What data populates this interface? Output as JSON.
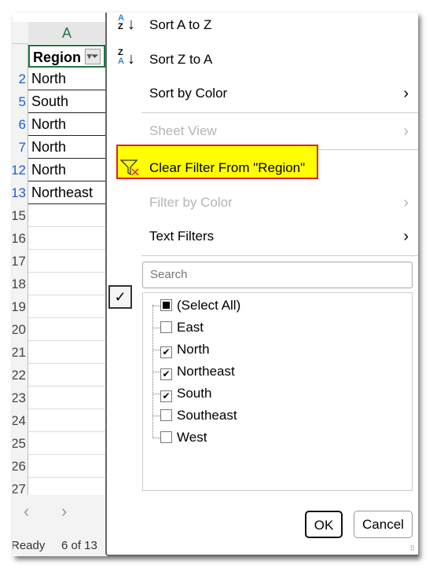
{
  "sheet": {
    "column_header": "A",
    "header_cell": "Region",
    "filter_icon": "filter-dropdown-icon",
    "row_numbers": [
      "2",
      "5",
      "6",
      "7",
      "12",
      "13",
      "15",
      "16",
      "17",
      "18",
      "19",
      "20",
      "21",
      "22",
      "23",
      "24",
      "25",
      "26",
      "27"
    ],
    "filtered_row_numbers_count": 6,
    "cells": [
      "North",
      "South",
      "North",
      "North",
      "North",
      "Northeast"
    ],
    "status_ready": "Ready",
    "status_count": "6 of 13"
  },
  "menu": {
    "sort_az": "Sort A to Z",
    "sort_za": "Sort Z to A",
    "sort_by_color": "Sort by Color",
    "sheet_view": "Sheet View",
    "clear_filter": "Clear Filter From \"Region\"",
    "filter_by_color": "Filter by Color",
    "text_filters": "Text Filters",
    "search_placeholder": "Search",
    "items": [
      {
        "label": "(Select All)",
        "state": "partial"
      },
      {
        "label": "East",
        "state": "unchecked"
      },
      {
        "label": "North",
        "state": "checked"
      },
      {
        "label": "Northeast",
        "state": "checked"
      },
      {
        "label": "South",
        "state": "checked"
      },
      {
        "label": "Southeast",
        "state": "unchecked"
      },
      {
        "label": "West",
        "state": "unchecked"
      }
    ],
    "ok": "OK",
    "cancel": "Cancel"
  },
  "colors": {
    "highlight": "#ffff00",
    "highlight_border": "#e02020",
    "excel_green": "#217346",
    "filtered_row": "#1a5fd6"
  }
}
